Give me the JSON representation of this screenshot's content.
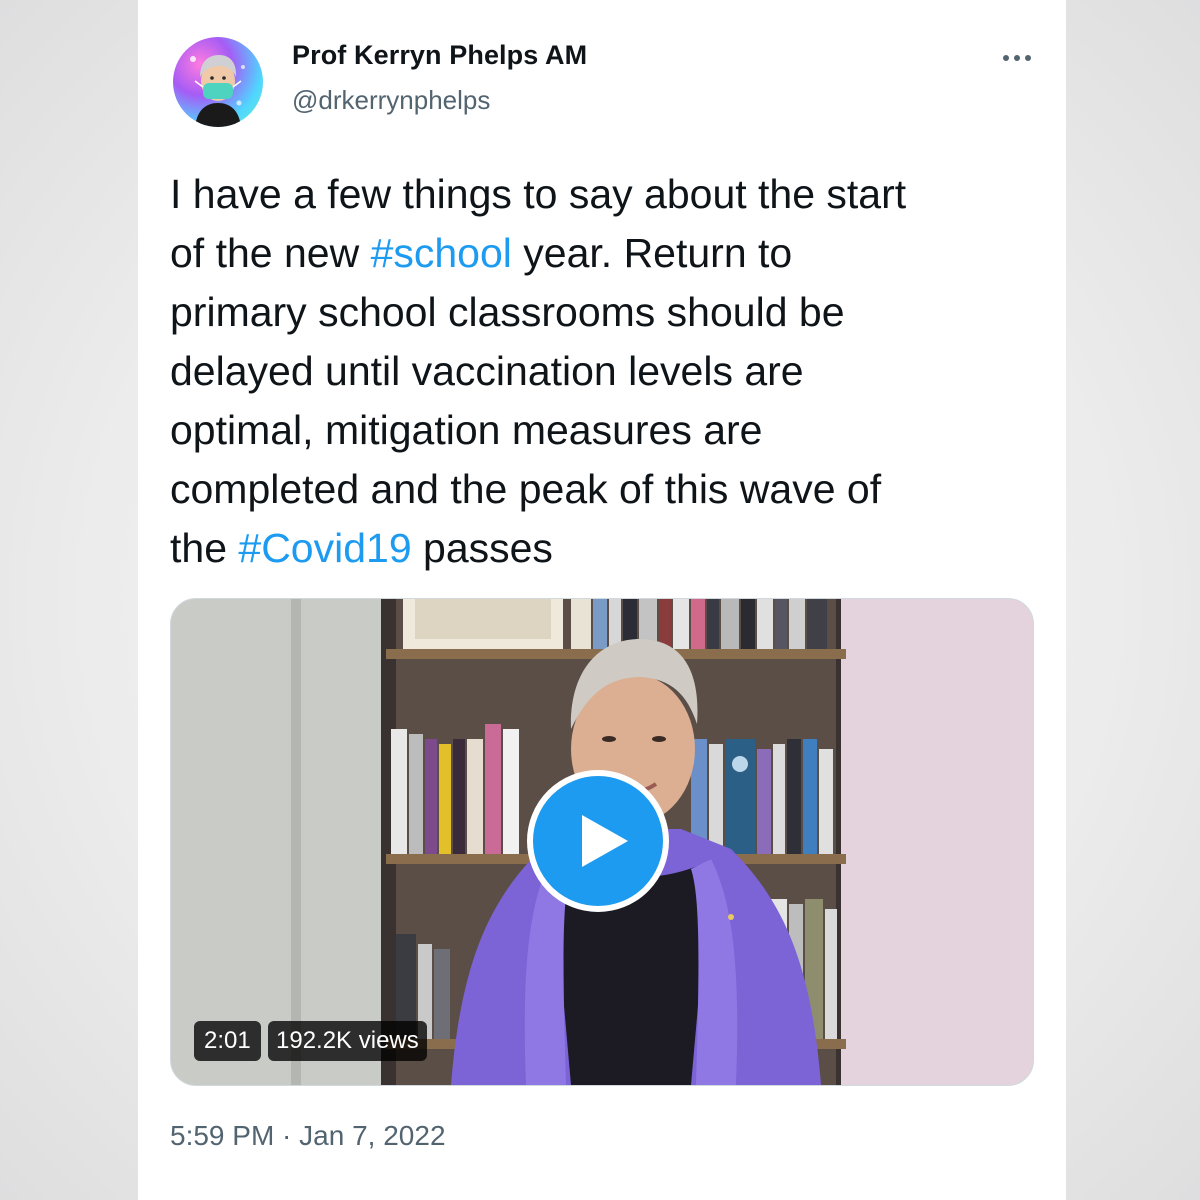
{
  "author": {
    "name": "Prof Kerryn Phelps AM",
    "handle": "@drkerrynphelps",
    "avatar_icon": "memoji-avatar-icon"
  },
  "tweet": {
    "lines": [
      {
        "before": "I have a few things to say about the start",
        "tag": "",
        "after": ""
      },
      {
        "before": "of the new ",
        "tag": "#school",
        "after": " year. Return to"
      },
      {
        "before": "primary school classrooms should be",
        "tag": "",
        "after": ""
      },
      {
        "before": "delayed until vaccination levels are",
        "tag": "",
        "after": ""
      },
      {
        "before": "optimal, mitigation measures are",
        "tag": "",
        "after": ""
      },
      {
        "before": "completed and the peak of this wave of",
        "tag": "",
        "after": ""
      },
      {
        "before": "the ",
        "tag": "#Covid19",
        "after": " passes"
      }
    ]
  },
  "video": {
    "duration": "2:01",
    "views": "192.2K views",
    "play_icon": "play-icon"
  },
  "timestamp": {
    "time": "5:59 PM",
    "separator": " · ",
    "date": "Jan 7, 2022"
  },
  "colors": {
    "text": "#0f1419",
    "secondary": "#536471",
    "accent": "#1d9bf0"
  }
}
